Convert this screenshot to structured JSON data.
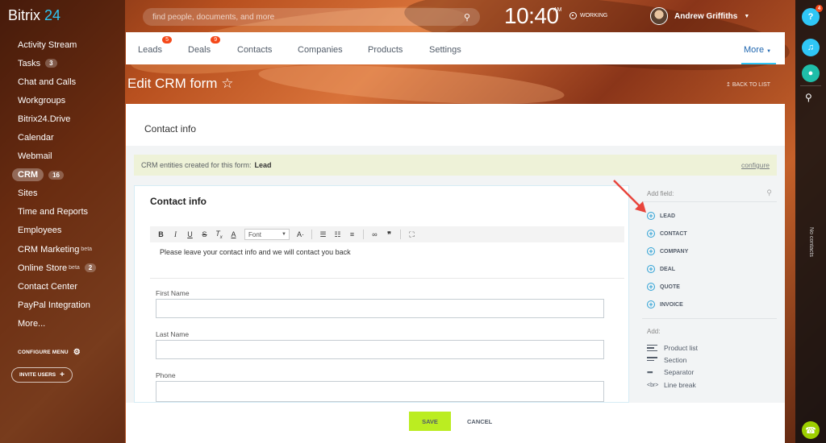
{
  "app": {
    "logo_name": "Bitrix",
    "logo_num": "24"
  },
  "sidebar": {
    "items": [
      {
        "label": "Activity Stream",
        "badge": ""
      },
      {
        "label": "Tasks",
        "badge": "3"
      },
      {
        "label": "Chat and Calls",
        "badge": ""
      },
      {
        "label": "Workgroups",
        "badge": ""
      },
      {
        "label": "Bitrix24.Drive",
        "badge": ""
      },
      {
        "label": "Calendar",
        "badge": ""
      },
      {
        "label": "Webmail",
        "badge": ""
      },
      {
        "label": "CRM",
        "badge": "16",
        "active": true
      },
      {
        "label": "Sites",
        "badge": ""
      },
      {
        "label": "Time and Reports",
        "badge": ""
      },
      {
        "label": "Employees",
        "badge": ""
      },
      {
        "label": "CRM Marketing",
        "sup": "beta",
        "badge": ""
      },
      {
        "label": "Online Store",
        "sup": "beta",
        "badge": "2"
      },
      {
        "label": "Contact Center",
        "badge": ""
      },
      {
        "label": "PayPal Integration",
        "badge": ""
      },
      {
        "label": "More...",
        "badge": ""
      }
    ],
    "configure_menu": "CONFIGURE MENU",
    "invite_users": "INVITE USERS"
  },
  "header": {
    "search_placeholder": "find people, documents, and more",
    "time": "10:40",
    "ampm": "AM",
    "status": "WORKING",
    "user_name": "Andrew Griffiths"
  },
  "rightbar": {
    "help_badge": "4",
    "no_contacts": "No contacts"
  },
  "tabs": {
    "leads": "Leads",
    "leads_badge": "5",
    "deals": "Deals",
    "deals_badge": "9",
    "contacts": "Contacts",
    "companies": "Companies",
    "products": "Products",
    "settings": "Settings",
    "more": "More"
  },
  "page": {
    "title": "Edit CRM form",
    "back": "BACK TO LIST",
    "section_title": "Contact info",
    "notice_text": "CRM entities created for this form:",
    "notice_entity": "Lead",
    "configure": "configure"
  },
  "form": {
    "title": "Contact info",
    "font_select": "Font",
    "editor_text": "Please leave your contact info and we will contact you back",
    "fields": [
      {
        "label": "First Name"
      },
      {
        "label": "Last Name"
      },
      {
        "label": "Phone"
      }
    ]
  },
  "side": {
    "add_field": "Add field:",
    "entities": [
      "LEAD",
      "CONTACT",
      "COMPANY",
      "DEAL",
      "QUOTE",
      "INVOICE"
    ],
    "add": "Add:",
    "add_items": [
      "Product list",
      "Section",
      "Separator",
      "Line break"
    ],
    "br_glyph": "<br>"
  },
  "footer": {
    "save": "SAVE",
    "cancel": "CANCEL"
  },
  "colors": {
    "accent": "#2fc6f6",
    "badge": "#f54819",
    "save": "#bbed21",
    "arrow": "#e8453c"
  }
}
